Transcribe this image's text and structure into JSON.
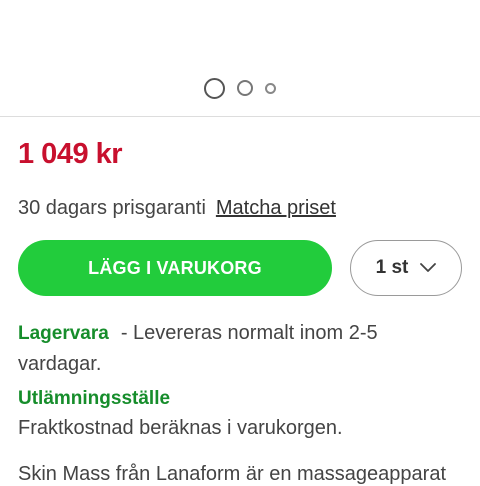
{
  "carousel": {
    "slide_count": 3,
    "active_index": 0
  },
  "product": {
    "price": "1 049 kr",
    "price_guarantee": "30 dagars prisgaranti",
    "match_price_link": "Matcha priset",
    "add_to_cart_label": "LÄGG I VARUKORG",
    "quantity": "1 st",
    "stock_status": "Lagervara",
    "delivery_info": "- Levereras normalt inom 2-5 vardagar.",
    "pickup_title": "Utlämningsställe",
    "pickup_info": "Fraktkostnad beräknas i varukorgen.",
    "description_preview": "Skin Mass från Lanaform är en massageapparat"
  },
  "colors": {
    "price": "#c8102e",
    "add_to_cart_bg": "#22cc3c",
    "stock_green": "#168d2b"
  }
}
